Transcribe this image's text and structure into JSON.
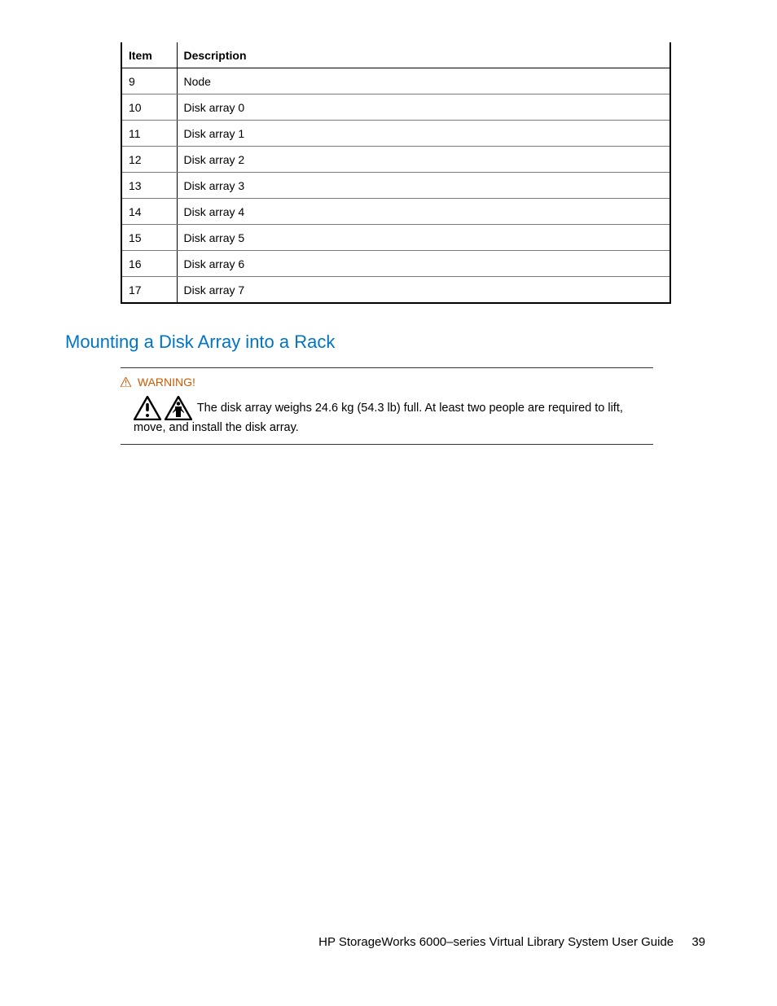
{
  "table": {
    "headers": {
      "item": "Item",
      "description": "Description"
    },
    "rows": [
      {
        "item": "9",
        "description": "Node"
      },
      {
        "item": "10",
        "description": "Disk array 0"
      },
      {
        "item": "11",
        "description": "Disk array 1"
      },
      {
        "item": "12",
        "description": "Disk array 2"
      },
      {
        "item": "13",
        "description": "Disk array 3"
      },
      {
        "item": "14",
        "description": "Disk array 4"
      },
      {
        "item": "15",
        "description": "Disk array 5"
      },
      {
        "item": "16",
        "description": "Disk array 6"
      },
      {
        "item": "17",
        "description": "Disk array 7"
      }
    ]
  },
  "section_heading": "Mounting a Disk Array into a Rack",
  "warning": {
    "label": "WARNING!",
    "text": "The disk array weighs 24.6 kg (54.3 lb) full. At least two people are required to lift, move, and install the disk array."
  },
  "footer": {
    "title": "HP StorageWorks 6000–series Virtual Library System User Guide",
    "page": "39"
  }
}
